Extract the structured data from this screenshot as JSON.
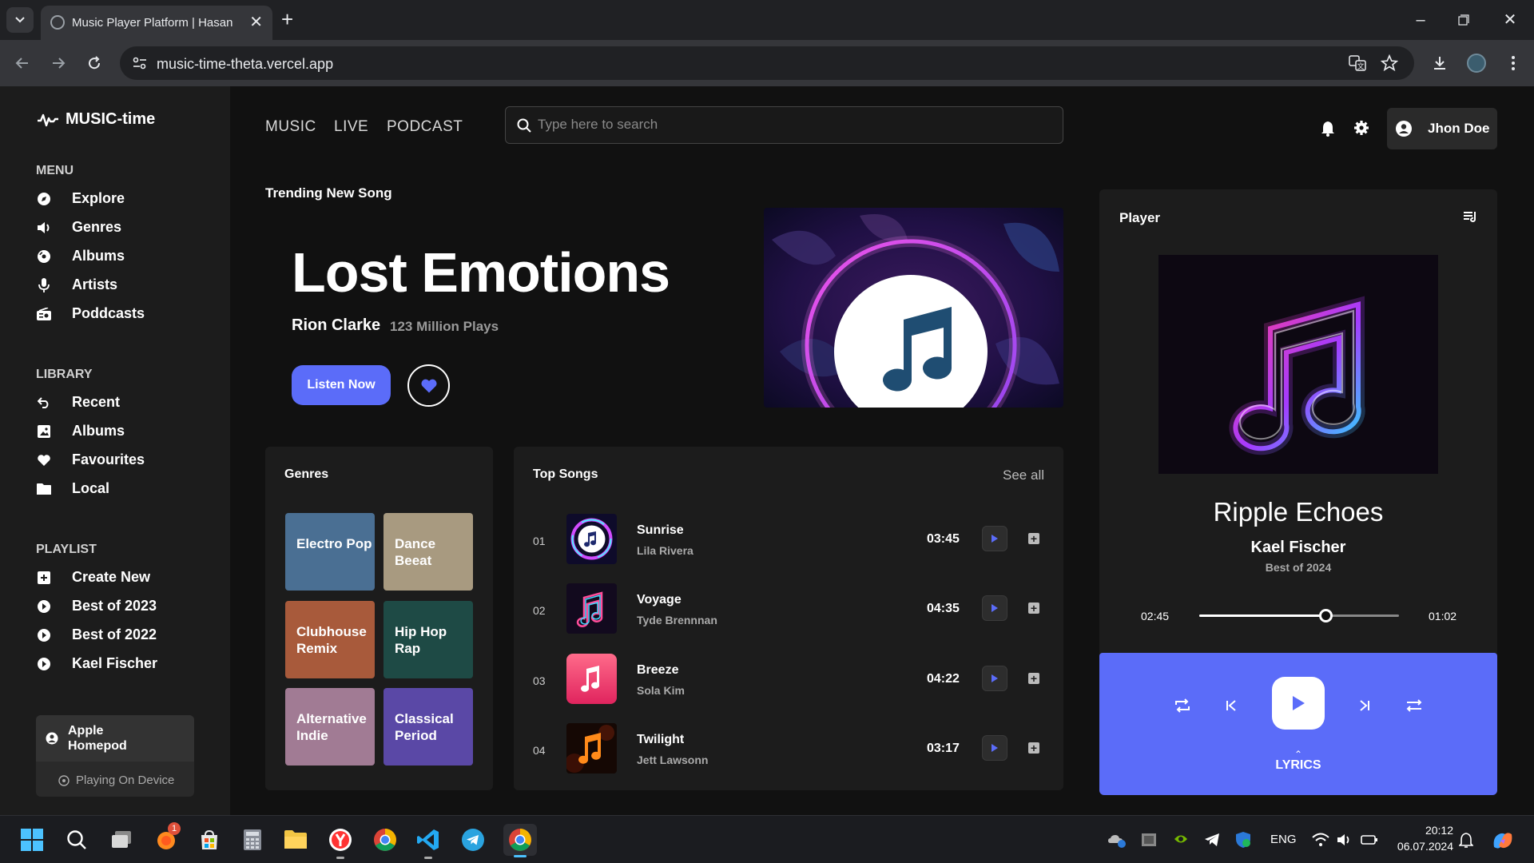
{
  "browser": {
    "tab_title": "Music Player Platform | Hasan",
    "url": "music-time-theta.vercel.app"
  },
  "app": {
    "logo": "MUSIC-time",
    "sections": {
      "menu": "MENU",
      "library": "LIBRARY",
      "playlist": "PLAYLIST"
    },
    "menu": [
      {
        "label": "Explore",
        "icon": "compass-icon"
      },
      {
        "label": "Genres",
        "icon": "speaker-icon"
      },
      {
        "label": "Albums",
        "icon": "disc-icon"
      },
      {
        "label": "Artists",
        "icon": "microphone-icon"
      },
      {
        "label": "Poddcasts",
        "icon": "radio-icon"
      }
    ],
    "library": [
      {
        "label": "Recent",
        "icon": "history-icon"
      },
      {
        "label": "Albums",
        "icon": "album-icon"
      },
      {
        "label": "Favourites",
        "icon": "heart-icon"
      },
      {
        "label": "Local",
        "icon": "folder-icon"
      }
    ],
    "playlist": [
      {
        "label": "Create New",
        "icon": "plus-square-icon"
      },
      {
        "label": "Best of 2023",
        "icon": "play-circle-icon"
      },
      {
        "label": "Best of 2022",
        "icon": "play-circle-icon"
      },
      {
        "label": "Kael Fischer",
        "icon": "play-circle-icon"
      }
    ],
    "device": {
      "name": "Apple Homepod",
      "status": "Playing On Device"
    },
    "topnav": [
      "MUSIC",
      "LIVE",
      "PODCAST"
    ],
    "search_placeholder": "Type here to search",
    "user": "Jhon Doe",
    "hero": {
      "label": "Trending New Song",
      "title": "Lost Emotions",
      "artist": "Rion Clarke",
      "plays": "123 Million Plays",
      "listen": "Listen Now"
    },
    "genres": {
      "title": "Genres",
      "items": [
        {
          "label": "Electro Pop",
          "color": "#4a6f93"
        },
        {
          "label": "Dance Beeat",
          "color": "#a89a80"
        },
        {
          "label": "Clubhouse Remix",
          "color": "#a85a3b"
        },
        {
          "label": "Hip Hop Rap",
          "color": "#1e4a45"
        },
        {
          "label": "Alternative Indie",
          "color": "#a17b94"
        },
        {
          "label": "Classical Period",
          "color": "#5a48a6"
        }
      ]
    },
    "top_songs": {
      "title": "Top Songs",
      "see_all": "See all",
      "items": [
        {
          "num": "01",
          "name": "Sunrise",
          "artist": "Lila Rivera",
          "duration": "03:45"
        },
        {
          "num": "02",
          "name": "Voyage",
          "artist": "Tyde Brennnan",
          "duration": "04:35"
        },
        {
          "num": "03",
          "name": "Breeze",
          "artist": "Sola Kim",
          "duration": "04:22"
        },
        {
          "num": "04",
          "name": "Twilight",
          "artist": "Jett Lawsonn",
          "duration": "03:17"
        }
      ]
    },
    "player": {
      "title": "Player",
      "song": "Ripple Echoes",
      "artist": "Kael Fischer",
      "album": "Best of 2024",
      "elapsed": "02:45",
      "remaining": "01:02",
      "progress": 0.63,
      "lyrics": "LYRICS"
    },
    "accent": "#5b6cf9"
  },
  "taskbar": {
    "lang": "ENG",
    "time": "20:12",
    "date": "06.07.2024",
    "badge": "1"
  }
}
